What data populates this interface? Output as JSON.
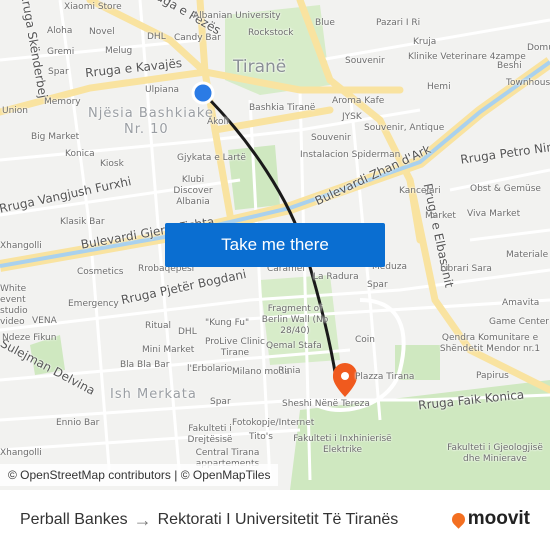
{
  "map": {
    "city_label": "Tiranë",
    "area_labels": [
      "Njësia Bashkiake",
      "Nr. 10",
      "Ish Merkata"
    ],
    "street_labels": [
      "Rruga e Kavajës",
      "Rruga Vangjush Furxhi",
      "Bulevardi Gjergj Fishta",
      "Bulevardi Zhan d'Ark",
      "Rruga Petro Nini",
      "Rruga e Elbasanit",
      "Rruga Pjetër Bogdani",
      "Rruga Faik Konica",
      "Rruga Skënderbej",
      "Sulejman Delvina",
      "Rruga e Pezës"
    ],
    "poi_labels": [
      "Xiaomi Store",
      "Albanian University",
      "Blue",
      "Pazari I Ri",
      "Aloha",
      "Novel",
      "DHL",
      "Candy Bar",
      "Rockstock",
      "Kruja",
      "Gremi",
      "Melug",
      "Souvenir",
      "Klinike Veterinare 4zampe",
      "Spar",
      "Ulpiana",
      "Beshi",
      "Memory",
      "Union",
      "Bashkia Tiranë",
      "Aroma Kafe",
      "Hemi",
      "Akoli",
      "JYSK",
      "Souvenir, Antique",
      "Big Market",
      "Souvenir",
      "Konica",
      "Instalacion Spiderman",
      "Kiosk",
      "Gjykata e Lartë",
      "Klubi Discover Albania",
      "Kancelari",
      "Obst & Gemüse",
      "Klasik Bar",
      "Market",
      "Viva Market",
      "Xhangolli",
      "Cosmetics",
      "Rrobaqepesi",
      "Caramel",
      "La Radura",
      "Meduza",
      "Librari Sara",
      "Materiale N",
      "White event studio video",
      "Spar",
      "Emergency",
      "Fragment of Berlin Wall (No 28/40)",
      "Amavita",
      "VENA",
      "Ritual",
      "DHL",
      "\"Kung Fu\"",
      "Game Center",
      "Ndeze Fikun",
      "Qemal Stafa",
      "Coin",
      "ProLive Clinic Tirane",
      "Qendra Komunitare e Shëndetit Mendor nr.1",
      "Mini Market",
      "Bla Bla Bar",
      "l'Erbolario",
      "Milano moda",
      "Rinia",
      "Papirus",
      "Spar",
      "Sheshi Nënë Tereza",
      "Ennio Bar",
      "Fakulteti i Drejtësisë",
      "Fotokopje/Internet",
      "Tito's",
      "Fakulteti i Inxhinierisë Elektrike",
      "Fakulteti i Gjeologjisë dhe Minierave",
      "Central Tirana appartements",
      "Xhangolli",
      "Plazza Tirana",
      "Domus",
      "Townhouse"
    ],
    "origin_color": "#2b7be5",
    "destination_color": "#f05a1e",
    "route_color": "#1a1a1a"
  },
  "cta": {
    "label": "Take me there"
  },
  "attribution": "© OpenStreetMap contributors | © OpenMapTiles",
  "footer": {
    "origin": "Perball Bankes",
    "arrow": "→",
    "destination": "Rektorati I Universitetit Të Tiranës"
  },
  "brand": {
    "name": "moovit",
    "color": "#f36f21"
  }
}
